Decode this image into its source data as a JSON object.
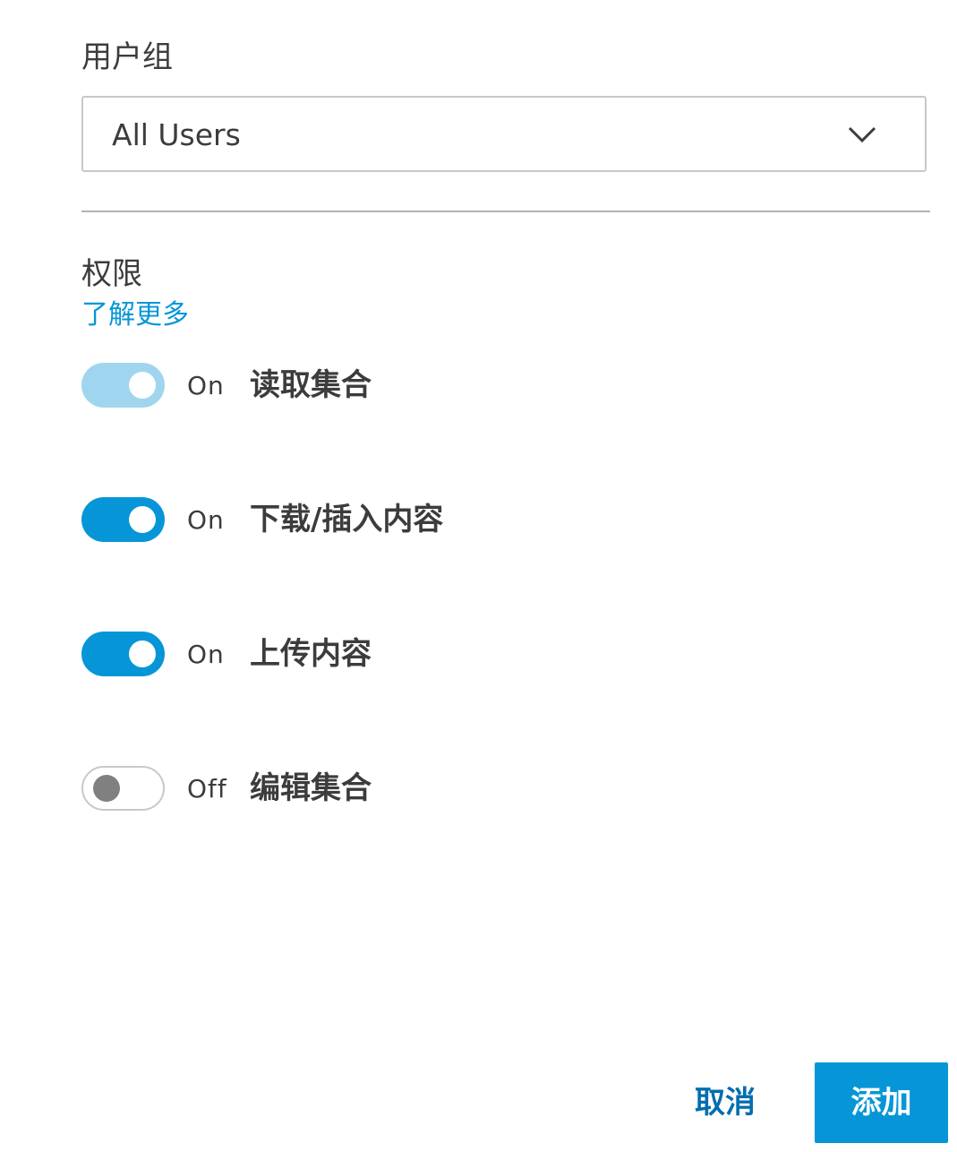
{
  "user_group": {
    "label": "用户组",
    "selected": "All Users"
  },
  "permissions": {
    "title": "权限",
    "learn_more": "了解更多",
    "items": [
      {
        "state": "On",
        "label": "读取集合",
        "on": true,
        "disabled": true
      },
      {
        "state": "On",
        "label": "下载/插入内容",
        "on": true,
        "disabled": false
      },
      {
        "state": "On",
        "label": "上传内容",
        "on": true,
        "disabled": false
      },
      {
        "state": "Off",
        "label": "编辑集合",
        "on": false,
        "disabled": false
      }
    ]
  },
  "actions": {
    "cancel": "取消",
    "add": "添加"
  },
  "colors": {
    "accent": "#0696d7",
    "accent_disabled": "#a0d5ef",
    "link": "#0696d7",
    "cancel_text": "#006eaf"
  }
}
